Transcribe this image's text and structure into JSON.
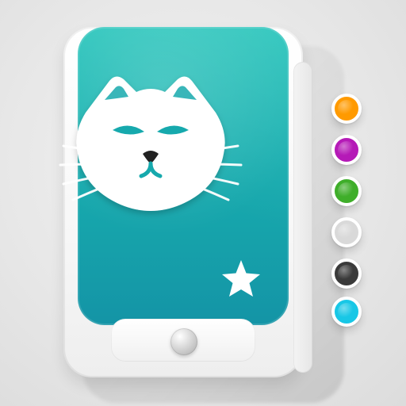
{
  "icons": {
    "cat": "cat-face-icon",
    "star": "star-icon"
  },
  "colors": {
    "screen_top": "#1fc2b8",
    "screen_bottom": "#1494a6",
    "cat_fill": "#ffffff",
    "cat_accent": "#16a9ad"
  },
  "palette": [
    {
      "name": "orange",
      "color": "#ff9a00"
    },
    {
      "name": "magenta",
      "color": "#b51ab7"
    },
    {
      "name": "green",
      "color": "#3fae2a"
    },
    {
      "name": "light-gray",
      "color": "#d9d9d9"
    },
    {
      "name": "charcoal",
      "color": "#3a3a3a"
    },
    {
      "name": "cyan",
      "color": "#18c7e6"
    }
  ]
}
